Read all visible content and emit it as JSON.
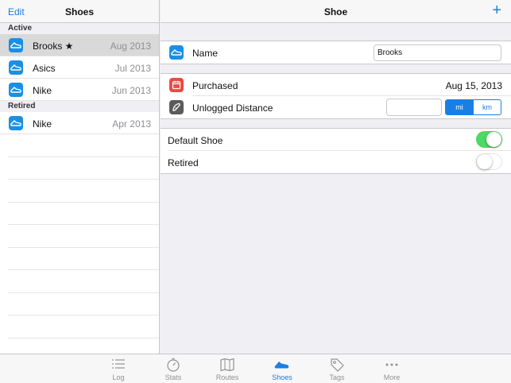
{
  "master": {
    "edit_label": "Edit",
    "title": "Shoes",
    "sections": {
      "active_header": "Active",
      "retired_header": "Retired"
    },
    "active_shoes": [
      {
        "name": "Brooks ★",
        "date": "Aug 2013"
      },
      {
        "name": "Asics",
        "date": "Jul 2013"
      },
      {
        "name": "Nike",
        "date": "Jun 2013"
      }
    ],
    "retired_shoes": [
      {
        "name": "Nike",
        "date": "Apr 2013"
      }
    ]
  },
  "detail": {
    "title": "Shoe",
    "add_label": "+",
    "name_label": "Name",
    "name_value": "Brooks",
    "purchased_label": "Purchased",
    "purchased_value": "Aug 15, 2013",
    "unlogged_label": "Unlogged Distance",
    "unlogged_value": "",
    "unit_options": [
      "mi",
      "km"
    ],
    "unit_selected": "mi",
    "default_shoe_label": "Default Shoe",
    "default_shoe_on": true,
    "retired_label": "Retired",
    "retired_on": false
  },
  "tabbar": {
    "tabs": [
      {
        "label": "Log",
        "icon": "list-icon"
      },
      {
        "label": "Stats",
        "icon": "stopwatch-icon"
      },
      {
        "label": "Routes",
        "icon": "map-icon"
      },
      {
        "label": "Shoes",
        "icon": "shoe-icon"
      },
      {
        "label": "Tags",
        "icon": "tag-icon"
      },
      {
        "label": "More",
        "icon": "ellipsis-icon"
      }
    ],
    "active": "Shoes"
  },
  "colors": {
    "accent": "#1a7fe5",
    "toggle_on": "#4cd964",
    "shoe_tile": "#1a8fe3",
    "calendar_tile": "#e94b43",
    "distance_tile": "#5b5b5b"
  }
}
